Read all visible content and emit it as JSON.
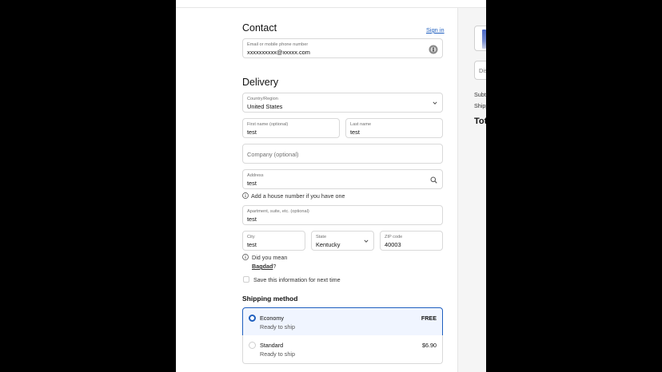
{
  "contact": {
    "title": "Contact",
    "sign_in": "Sign in",
    "email_label": "Email or mobile phone number",
    "email_value": "xxxxxxxxxx@xxxxx.com"
  },
  "delivery": {
    "title": "Delivery",
    "country_label": "Country/Region",
    "country_value": "United States",
    "first_name_label": "First name (optional)",
    "first_name_value": "test",
    "last_name_label": "Last name",
    "last_name_value": "test",
    "company_placeholder": "Company (optional)",
    "address_label": "Address",
    "address_value": "test",
    "house_number_note": "Add a house number if you have one",
    "apartment_label": "Apartment, suite, etc. (optional)",
    "apartment_value": "test",
    "city_label": "City",
    "city_value": "test",
    "state_label": "State",
    "state_value": "Kentucky",
    "zip_label": "ZIP code",
    "zip_value": "40003",
    "did_you_mean": "Did you mean",
    "suggestion": "Bagdad",
    "suggestion_suffix": "?",
    "save_info_label": "Save this information for next time"
  },
  "shipping": {
    "title": "Shipping method",
    "options": [
      {
        "name": "Economy",
        "sub": "Ready to ship",
        "price": "FREE",
        "selected": true
      },
      {
        "name": "Standard",
        "sub": "Ready to ship",
        "price": "$6.90",
        "selected": false
      }
    ]
  },
  "summary": {
    "discount_placeholder": "Dis",
    "subtotal_label": "Subto",
    "shipping_label": "Shipp",
    "total_label": "Tota"
  },
  "colors": {
    "accent": "#1f5fbf",
    "selected_bg": "#f0f5ff",
    "border": "#d9d9d9",
    "summary_bg": "#f5f5f5"
  }
}
